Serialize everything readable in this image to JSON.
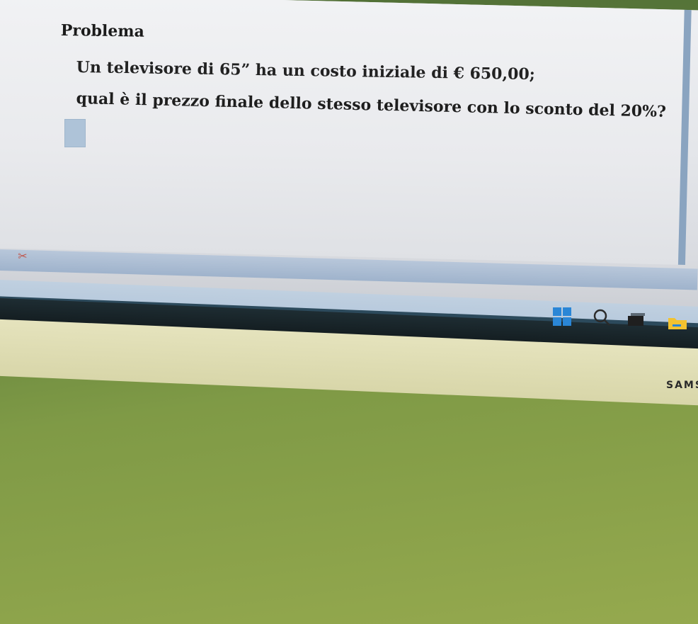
{
  "document": {
    "title": "Problema",
    "line1": "Un televisore di 65” ha un costo iniziale di € 650,00;",
    "line2": "qual è il prezzo finale dello stesso televisore con lo sconto del 20%?"
  },
  "monitor": {
    "brand": "SAMS"
  },
  "taskbar": {
    "icons": [
      "windows-start-icon",
      "search-icon",
      "task-view-icon",
      "file-explorer-icon"
    ]
  },
  "colors": {
    "accent": "#2a86d6",
    "answer_box": "#aec3d8",
    "desk": "#7f9a46"
  }
}
